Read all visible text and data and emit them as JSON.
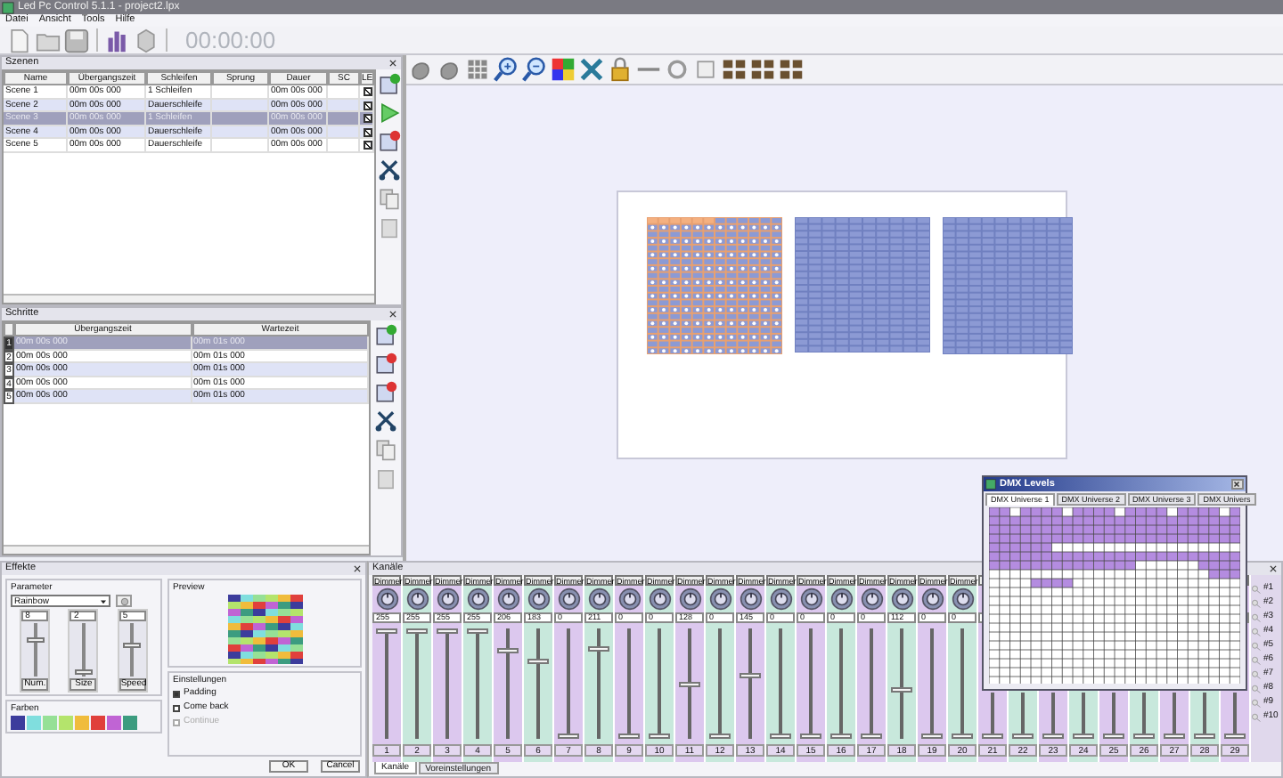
{
  "window": {
    "title": "Led Pc Control 5.1.1 - project2.lpx"
  },
  "menu": [
    "Datei",
    "Ansicht",
    "Tools",
    "Hilfe"
  ],
  "timer": "00:00:00",
  "scenes": {
    "title": "Szenen",
    "columns": [
      "Name",
      "Übergangszeit",
      "Schleifen",
      "Sprung",
      "Dauer",
      "SC",
      "LE"
    ],
    "rows": [
      {
        "cells": [
          "Scene 1",
          "00m 00s 000",
          "1 Schleifen",
          "",
          "00m 00s 000",
          ""
        ],
        "checked": true,
        "selected": false
      },
      {
        "cells": [
          "Scene 2",
          "00m 00s 000",
          "Dauerschleife",
          "",
          "00m 00s 000",
          ""
        ],
        "checked": true,
        "selected": false
      },
      {
        "cells": [
          "Scene 3",
          "00m 00s 000",
          "1 Schleifen",
          "",
          "00m 00s 000",
          ""
        ],
        "checked": true,
        "selected": true
      },
      {
        "cells": [
          "Scene 4",
          "00m 00s 000",
          "Dauerschleife",
          "",
          "00m 00s 000",
          ""
        ],
        "checked": true,
        "selected": false
      },
      {
        "cells": [
          "Scene 5",
          "00m 00s 000",
          "Dauerschleife",
          "",
          "00m 00s 000",
          ""
        ],
        "checked": true,
        "selected": false
      }
    ]
  },
  "steps": {
    "title": "Schritte",
    "columns": [
      "Übergangszeit",
      "Wartezeit"
    ],
    "rows": [
      {
        "number": "1",
        "cells": [
          "00m 00s 000",
          "00m 01s 000"
        ],
        "selected": true
      },
      {
        "number": "2",
        "cells": [
          "00m 00s 000",
          "00m 01s 000"
        ],
        "selected": false
      },
      {
        "number": "3",
        "cells": [
          "00m 00s 000",
          "00m 01s 000"
        ],
        "selected": false
      },
      {
        "number": "4",
        "cells": [
          "00m 00s 000",
          "00m 01s 000"
        ],
        "selected": false
      },
      {
        "number": "5",
        "cells": [
          "00m 00s 000",
          "00m 01s 000"
        ],
        "selected": false
      }
    ]
  },
  "effects": {
    "title": "Effekte",
    "parameter_label": "Parameter",
    "effect": "Rainbow",
    "sliders": [
      {
        "value": "8",
        "level": 0.72,
        "button": "Num."
      },
      {
        "value": "2",
        "level": 0.05,
        "button": "Size"
      },
      {
        "value": "5",
        "level": 0.6,
        "button": "Speed"
      }
    ],
    "colors_label": "Farben",
    "colors": [
      {
        "color": "#3c3c9c"
      },
      {
        "color": "#80dede"
      },
      {
        "color": "#96e096"
      },
      {
        "color": "#b4e46c"
      },
      {
        "color": "#f0bc3c"
      },
      {
        "color": "#e0403c"
      },
      {
        "color": "#c064d4"
      },
      {
        "color": "#3c9c80"
      }
    ],
    "preview_label": "Preview",
    "settings_label": "Einstellungen",
    "options": [
      {
        "label": "Padding",
        "checked": true,
        "disabled": false
      },
      {
        "label": "Come back",
        "checked": false,
        "disabled": false
      },
      {
        "label": "Continue",
        "checked": false,
        "disabled": true
      }
    ],
    "buttons": [
      "OK",
      "Cancel"
    ]
  },
  "channels": {
    "title": "Kanäle",
    "strips": [
      {
        "label": "Dimmer",
        "value": "255",
        "level": 1,
        "number": "1"
      },
      {
        "label": "Dimmer",
        "value": "255",
        "level": 1,
        "number": "2"
      },
      {
        "label": "Dimmer",
        "value": "255",
        "level": 1,
        "number": "3"
      },
      {
        "label": "Dimmer",
        "value": "255",
        "level": 1,
        "number": "4"
      },
      {
        "label": "Dimmer",
        "value": "206",
        "level": 0.81,
        "number": "5"
      },
      {
        "label": "Dimmer",
        "value": "183",
        "level": 0.72,
        "number": "6"
      },
      {
        "label": "Dimmer",
        "value": "0",
        "level": 0,
        "number": "7"
      },
      {
        "label": "Dimmer",
        "value": "211",
        "level": 0.83,
        "number": "8"
      },
      {
        "label": "Dimmer",
        "value": "0",
        "level": 0,
        "number": "9"
      },
      {
        "label": "Dimmer",
        "value": "0",
        "level": 0,
        "number": "10"
      },
      {
        "label": "Dimmer",
        "value": "128",
        "level": 0.5,
        "number": "11"
      },
      {
        "label": "Dimmer",
        "value": "0",
        "level": 0,
        "number": "12"
      },
      {
        "label": "Dimmer",
        "value": "145",
        "level": 0.57,
        "number": "13"
      },
      {
        "label": "Dimmer",
        "value": "0",
        "level": 0,
        "number": "14"
      },
      {
        "label": "Dimmer",
        "value": "0",
        "level": 0,
        "number": "15"
      },
      {
        "label": "Dimmer",
        "value": "0",
        "level": 0,
        "number": "16"
      },
      {
        "label": "Dimmer",
        "value": "0",
        "level": 0,
        "number": "17"
      },
      {
        "label": "Dimmer",
        "value": "112",
        "level": 0.44,
        "number": "18"
      },
      {
        "label": "Dimmer",
        "value": "0",
        "level": 0,
        "number": "19"
      },
      {
        "label": "Dimmer",
        "value": "0",
        "level": 0,
        "number": "20"
      },
      {
        "level": 0,
        "number": "21"
      },
      {
        "level": 0,
        "number": "22"
      },
      {
        "level": 0,
        "number": "23"
      },
      {
        "level": 0,
        "number": "24"
      },
      {
        "level": 0,
        "number": "25"
      },
      {
        "level": 0,
        "number": "26"
      },
      {
        "level": 0,
        "number": "27"
      },
      {
        "level": 0,
        "number": "28"
      },
      {
        "level": 0,
        "number": "29"
      }
    ],
    "groups": [
      "#1",
      "#2",
      "#3",
      "#4",
      "#5",
      "#6",
      "#7",
      "#8",
      "#9",
      "#10"
    ],
    "tabs": [
      {
        "label": "Kanäle",
        "selected": true
      },
      {
        "label": "Voreinstellungen",
        "selected": false
      }
    ]
  },
  "dmx_window": {
    "title": "DMX Levels",
    "tabs": [
      {
        "label": "DMX Universe 1",
        "selected": true
      },
      {
        "label": "DMX Universe 2",
        "selected": false
      },
      {
        "label": "DMX Universe 3",
        "selected": false
      },
      {
        "label": "DMX Univers",
        "selected": false
      }
    ]
  }
}
